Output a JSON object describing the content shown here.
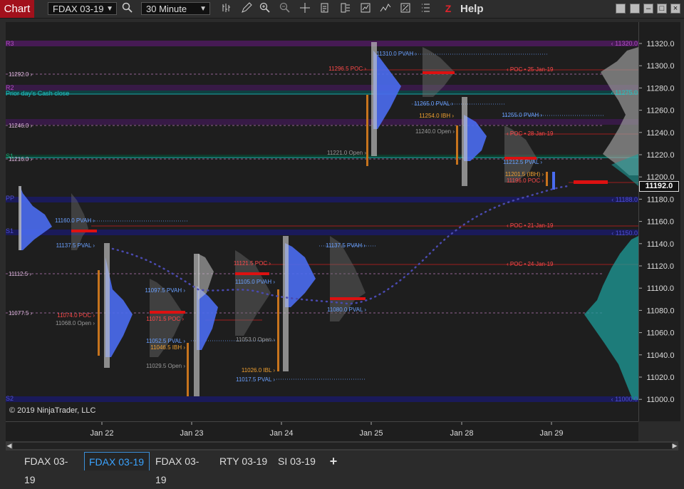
{
  "toolbar": {
    "title": "Chart",
    "instrument": "FDAX 03-19",
    "interval": "30 Minute",
    "help": "Help",
    "icons": [
      "search-icon",
      "bar-style-icon",
      "pencil-icon",
      "zoom-in-icon",
      "zoom-out-icon",
      "crosshair-icon",
      "data-box-icon",
      "templates-icon",
      "strategies-icon",
      "indicators-icon",
      "properties-icon",
      "list-icon",
      "z-logo-icon"
    ]
  },
  "chart": {
    "copyright": "© 2019 NinjaTrader, LLC",
    "current_price": "11192.0",
    "price_ticks": [
      "11320.0",
      "11300.0",
      "11280.0",
      "11260.0",
      "11240.0",
      "11220.0",
      "11200.0",
      "11180.0",
      "11160.0",
      "11140.0",
      "11120.0",
      "11100.0",
      "11080.0",
      "11060.0",
      "11040.0",
      "11020.0",
      "11000.0"
    ],
    "date_ticks": [
      "Jan 22",
      "Jan 23",
      "Jan 24",
      "Jan 25",
      "Jan 28",
      "Jan 29"
    ],
    "left_labels": [
      "11292.0",
      "11246.0",
      "11216.0",
      "11112.5",
      "11077.5"
    ],
    "band_labels": [
      "R3",
      "R2",
      "Prior day's Cash close",
      "S1",
      "PP",
      "S1",
      "S2"
    ],
    "right_band_labels": [
      "11320.0",
      "11275.0",
      "11188.0",
      "11150.0",
      "11000.0"
    ],
    "annotations": [
      {
        "text": "11310.0 PVAH",
        "color": "#6aa0ff"
      },
      {
        "text": "11296.5 POC",
        "color": "#ff4a4a"
      },
      {
        "text": "POC • 25-Jan-19",
        "color": "#ff4a4a"
      },
      {
        "text": "11265.0 PVAL",
        "color": "#6aa0ff"
      },
      {
        "text": "11254.0 IBH",
        "color": "#f0a030"
      },
      {
        "text": "11240.0 Open",
        "color": "#9a9a9a"
      },
      {
        "text": "11255.0 PVAH",
        "color": "#6aa0ff"
      },
      {
        "text": "POC • 28-Jan-19",
        "color": "#ff4a4a"
      },
      {
        "text": "11221.0 Open",
        "color": "#9a9a9a"
      },
      {
        "text": "11212.5 PVAL",
        "color": "#6aa0ff"
      },
      {
        "text": "11201.5 (IBH)",
        "color": "#f0a030"
      },
      {
        "text": "11196.0 POC",
        "color": "#ff4a4a"
      },
      {
        "text": "11160.0 PVAH",
        "color": "#6aa0ff"
      },
      {
        "text": "POC • 21-Jan-19",
        "color": "#ff4a4a"
      },
      {
        "text": "11137.5 PVAL",
        "color": "#6aa0ff"
      },
      {
        "text": "11137.5 PVAH",
        "color": "#6aa0ff"
      },
      {
        "text": "11121.5 POC",
        "color": "#ff4a4a"
      },
      {
        "text": "POC • 24-Jan-19",
        "color": "#ff4a4a"
      },
      {
        "text": "11105.0 PVAH",
        "color": "#6aa0ff"
      },
      {
        "text": "11097.5 PVAH",
        "color": "#6aa0ff"
      },
      {
        "text": "11080.0 PVAL",
        "color": "#6aa0ff"
      },
      {
        "text": "11074.0 POC",
        "color": "#ff4a4a"
      },
      {
        "text": "11068.0 Open",
        "color": "#9a9a9a"
      },
      {
        "text": "11071.5 POC",
        "color": "#ff4a4a"
      },
      {
        "text": "11052.5 PVAL",
        "color": "#6aa0ff"
      },
      {
        "text": "11046.5 IBH",
        "color": "#f0a030"
      },
      {
        "text": "11053.0 Open",
        "color": "#9a9a9a"
      },
      {
        "text": "11029.5 Open",
        "color": "#9a9a9a"
      },
      {
        "text": "11026.0 IBL",
        "color": "#f0a030"
      },
      {
        "text": "11017.5 PVAL",
        "color": "#6aa0ff"
      }
    ]
  },
  "tabs": [
    {
      "label": "FDAX 03-19",
      "active": false
    },
    {
      "label": "FDAX 03-19",
      "active": true
    },
    {
      "label": "FDAX 03-19",
      "active": false
    },
    {
      "label": "RTY 03-19",
      "active": false
    },
    {
      "label": "SI 03-19",
      "active": false
    }
  ],
  "add_tab": "+",
  "colors": {
    "accent": "#3aa3ff",
    "poc": "#ff2020",
    "title_bg": "#a2111c",
    "profile_blue": "#4a6cf0",
    "profile_teal": "#1d9c9a"
  }
}
